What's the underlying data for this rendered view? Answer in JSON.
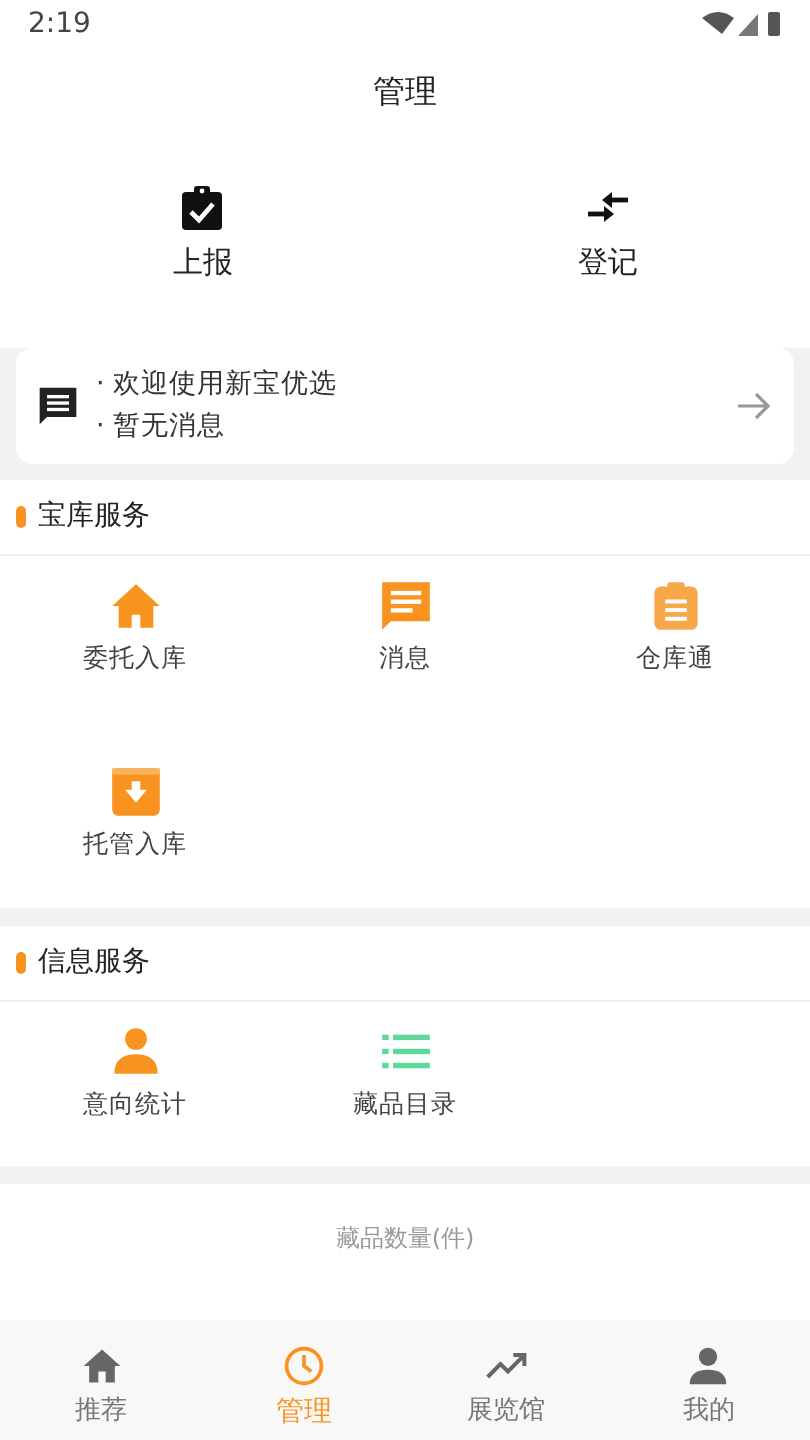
{
  "status_bar": {
    "time": "2:19"
  },
  "header": {
    "title": "管理"
  },
  "quick_actions": [
    {
      "label": "上报"
    },
    {
      "label": "登记"
    }
  ],
  "notice": {
    "lines": [
      "· 欢迎使用新宝优选",
      "· 暂无消息"
    ]
  },
  "sections": [
    {
      "title": "宝库服务",
      "items": [
        {
          "label": "委托入库"
        },
        {
          "label": "消息"
        },
        {
          "label": "仓库通"
        },
        {
          "label": "托管入库"
        }
      ]
    },
    {
      "title": "信息服务",
      "items": [
        {
          "label": "意向统计"
        },
        {
          "label": "藏品目录"
        }
      ]
    }
  ],
  "stats": {
    "label": "藏品数量(件)"
  },
  "bottom_nav": [
    {
      "label": "推荐",
      "selected": false
    },
    {
      "label": "管理",
      "selected": true
    },
    {
      "label": "展览馆",
      "selected": false
    },
    {
      "label": "我的",
      "selected": false
    }
  ]
}
